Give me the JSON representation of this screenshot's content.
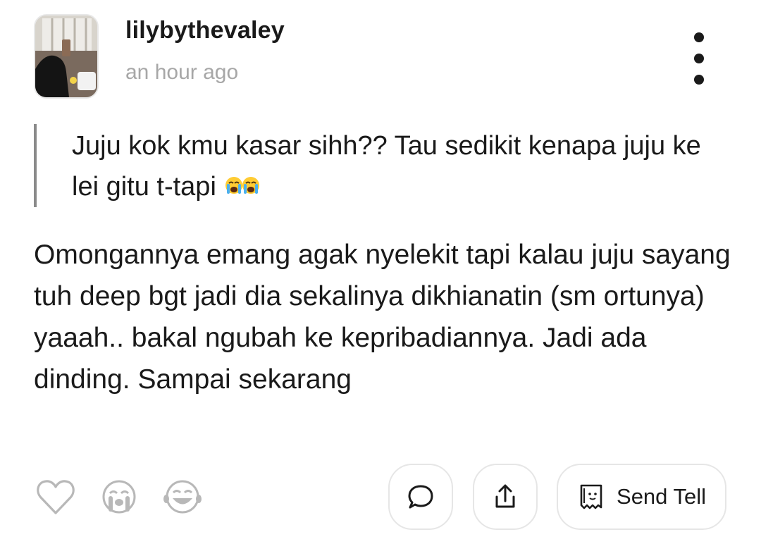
{
  "post": {
    "author": "lilybythevaley",
    "time": "an hour ago",
    "quote": "Juju kok kmu kasar sihh?? Tau sedikit kenapa juju ke lei gitu t-tapi",
    "quote_emojis": "😭😭",
    "body": "Omongannya emang agak nyelekit tapi kalau juju sayang tuh deep bgt jadi dia sekalinya dikhianatin (sm ortunya) yaaah.. bakal ngubah ke kepribadiannya. Jadi ada dinding. Sampai sekarang"
  },
  "actions": {
    "send_tell_label": "Send Tell"
  },
  "icons": {
    "avatar": "profile-photo",
    "more": "vertical-ellipsis-icon",
    "like": "heart-outline-icon",
    "cry": "crying-face-icon",
    "laugh": "laughing-face-icon",
    "comment": "speech-bubble-icon",
    "share": "share-upload-icon",
    "tell": "ghost-card-icon"
  },
  "colors": {
    "text": "#1a1a1a",
    "muted": "#a7a7a7",
    "icon_gray": "#b8b8b8",
    "border": "#e6e6e6"
  }
}
